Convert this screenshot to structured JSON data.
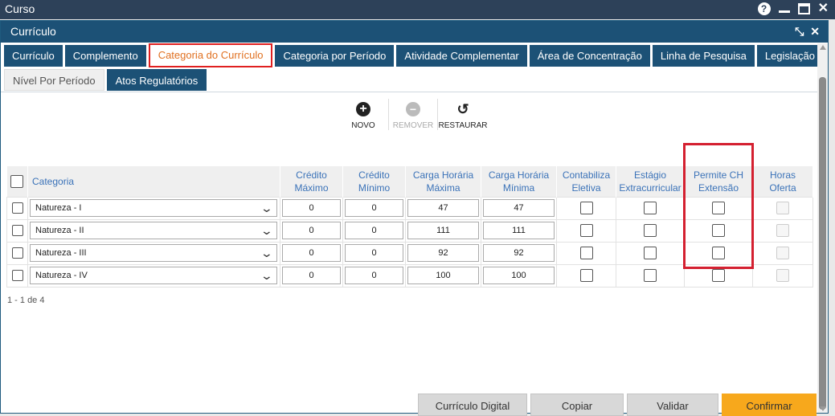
{
  "app": {
    "title": "Curso"
  },
  "window": {
    "title": "Currículo"
  },
  "tabs": [
    {
      "label": "Currículo"
    },
    {
      "label": "Complemento"
    },
    {
      "label": "Categoria do Currículo"
    },
    {
      "label": "Categoria por Período"
    },
    {
      "label": "Atividade Complementar"
    },
    {
      "label": "Área de Concentração"
    },
    {
      "label": "Linha de Pesquisa"
    },
    {
      "label": "Legislação"
    }
  ],
  "subtabs": [
    {
      "label": "Nível Por Período"
    },
    {
      "label": "Atos Regulatórios"
    }
  ],
  "toolbar": {
    "novo": "NOVO",
    "remover": "REMOVER",
    "restaurar": "RESTAURAR"
  },
  "table": {
    "headers": {
      "categoria": "Categoria",
      "credito_max": "Crédito Máximo",
      "credito_min": "Crédito Mínimo",
      "ch_max": "Carga Horária Máxima",
      "ch_min": "Carga Horária Mínima",
      "contabiliza": "Contabiliza Eletiva",
      "estagio": "Estágio Extracurricular",
      "permite": "Permite CH Extensão",
      "horas": "Horas Oferta"
    },
    "rows": [
      {
        "categoria": "Natureza - I",
        "credito_max": "0",
        "credito_min": "0",
        "ch_max": "47",
        "ch_min": "47"
      },
      {
        "categoria": "Natureza - II",
        "credito_max": "0",
        "credito_min": "0",
        "ch_max": "111",
        "ch_min": "111"
      },
      {
        "categoria": "Natureza - III",
        "credito_max": "0",
        "credito_min": "0",
        "ch_max": "92",
        "ch_min": "92"
      },
      {
        "categoria": "Natureza - IV",
        "credito_max": "0",
        "credito_min": "0",
        "ch_max": "100",
        "ch_min": "100"
      }
    ]
  },
  "pager": "1 - 1 de 4",
  "footer": {
    "digital": "Currículo Digital",
    "copiar": "Copiar",
    "validar": "Validar",
    "confirmar": "Confirmar"
  },
  "colors": {
    "header": "#1c5176",
    "highlight": "#d42030",
    "confirm": "#f7a81c",
    "active_tab_text": "#e07020"
  }
}
